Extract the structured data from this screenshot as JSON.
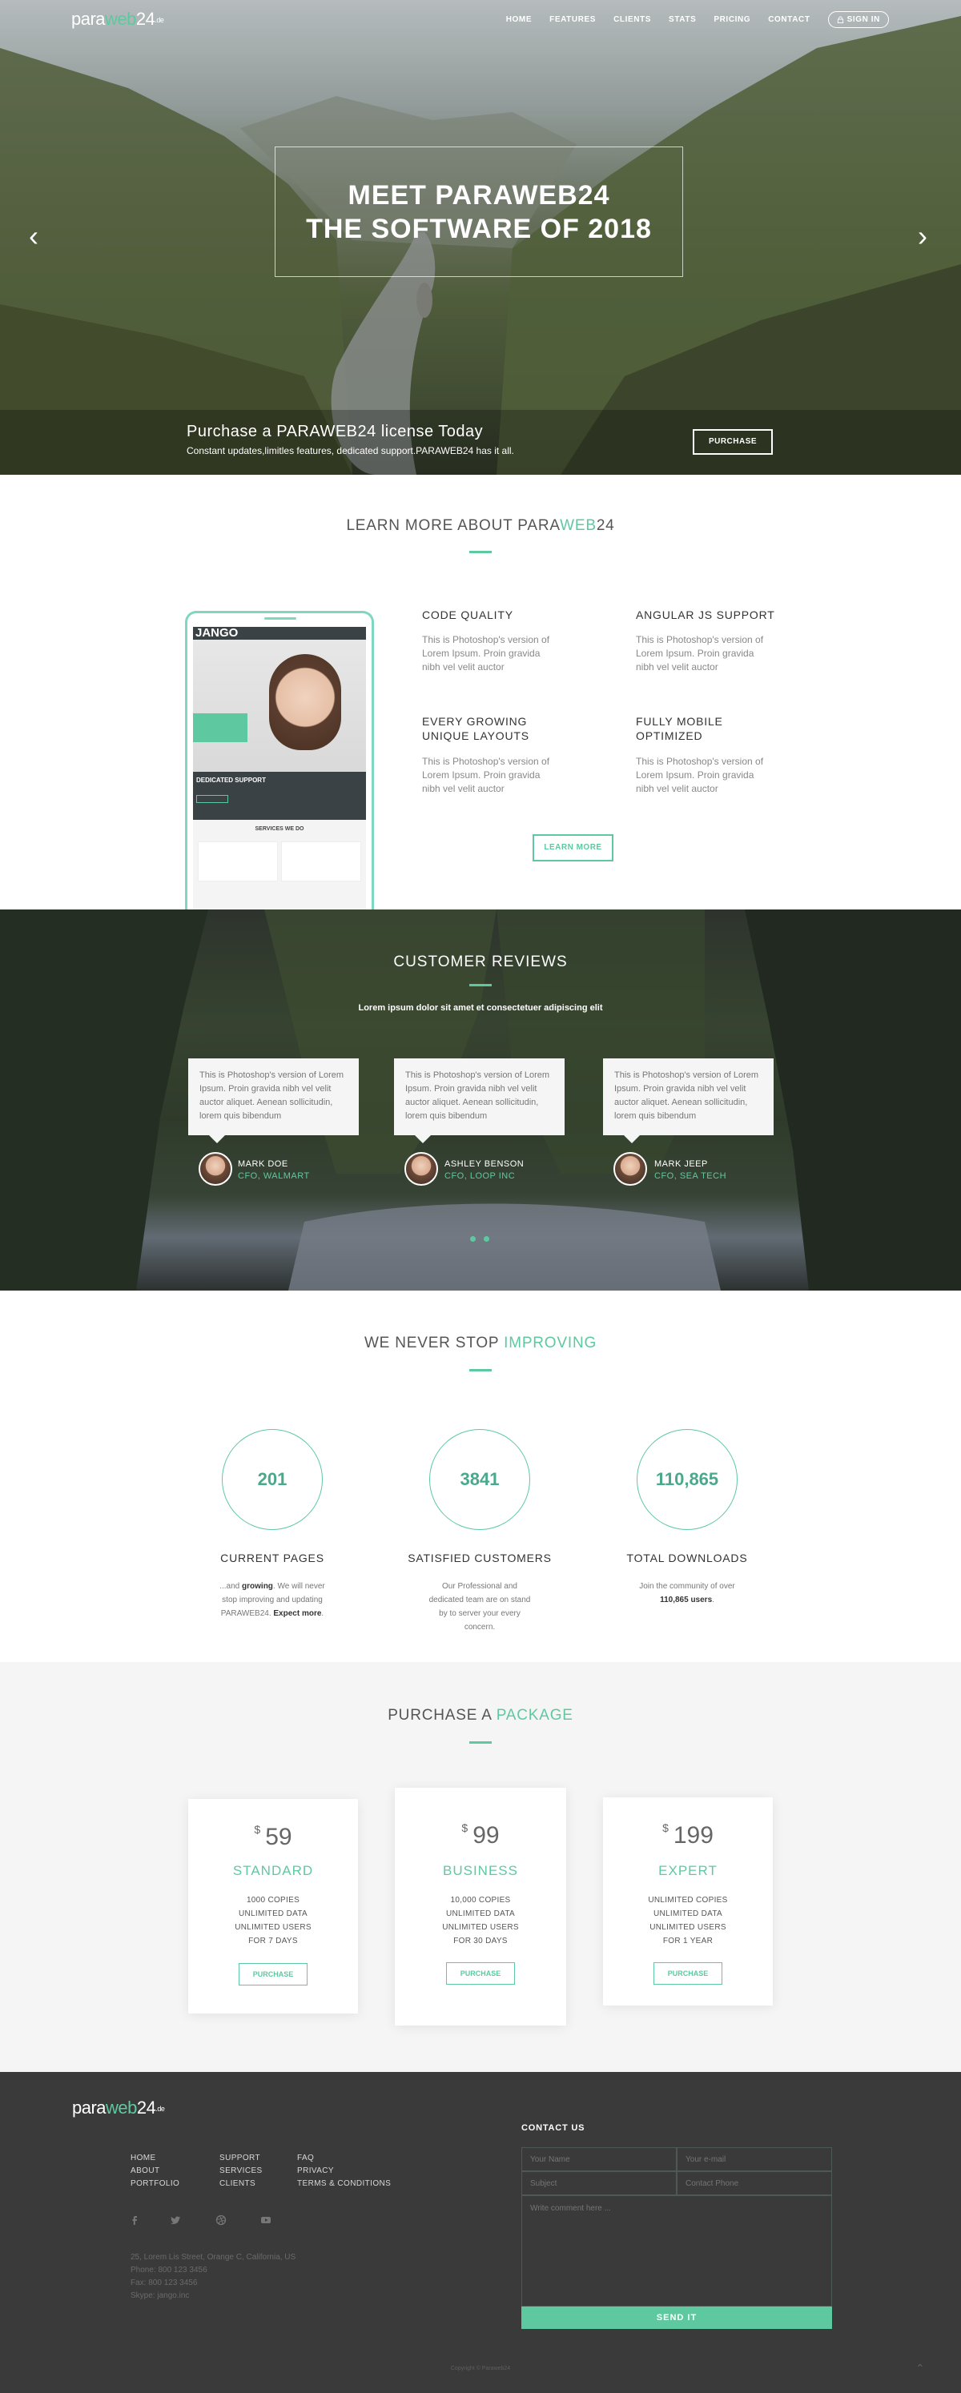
{
  "brand": {
    "logo_a": "para",
    "logo_b": "web",
    "logo_c": "24",
    "logo_tld": ".de"
  },
  "nav": {
    "items": [
      "HOME",
      "FEATURES",
      "CLIENTS",
      "STATS",
      "PRICING",
      "CONTACT"
    ],
    "signin": "SIGN IN"
  },
  "hero": {
    "line1": "MEET PARAWEB24",
    "line2": "THE SOFTWARE OF 2018",
    "prev": "‹",
    "next": "›",
    "band_title": "Purchase a PARAWEB24 license Today",
    "band_sub": "Constant updates,limitles features, dedicated support.PARAWEB24 has it all.",
    "purchase": "PURCHASE"
  },
  "learn": {
    "title_a": "LEARN MORE ABOUT PARA",
    "title_b": "WEB",
    "title_c": "24",
    "phone": {
      "brand": "JANGO",
      "support": "DEDICATED SUPPORT",
      "services": "SERVICES WE DO"
    },
    "features": [
      {
        "title": "CODE QUALITY",
        "text": "This is Photoshop's version of Lorem Ipsum. Proin gravida nibh vel velit auctor"
      },
      {
        "title": "ANGULAR JS SUPPORT",
        "text": "This is Photoshop's version of Lorem Ipsum. Proin gravida nibh vel velit auctor"
      },
      {
        "title": "EVERY GROWING UNIQUE LAYOUTS",
        "text": "This is Photoshop's version of Lorem Ipsum. Proin gravida nibh vel velit auctor"
      },
      {
        "title": "FULLY MOBILE OPTIMIZED",
        "text": "This is Photoshop's version of Lorem Ipsum. Proin gravida nibh vel velit auctor"
      }
    ],
    "button": "LEARN MORE"
  },
  "reviews": {
    "title": "CUSTOMER REVIEWS",
    "subtitle": "Lorem ipsum dolor sit amet et consectetuer adipiscing elit",
    "items": [
      {
        "text": "This is Photoshop's version  of Lorem Ipsum. Proin gravida nibh vel velit auctor aliquet. Aenean sollicitudin, lorem quis bibendum",
        "name": "MARK DOE",
        "role": "CFO, WALMART"
      },
      {
        "text": "This is Photoshop's version  of Lorem Ipsum. Proin gravida nibh vel velit auctor aliquet. Aenean sollicitudin, lorem quis bibendum",
        "name": "ASHLEY BENSON",
        "role": "CFO, LOOP INC"
      },
      {
        "text": "This is Photoshop's version  of Lorem Ipsum. Proin gravida nibh vel velit auctor aliquet. Aenean sollicitudin, lorem quis bibendum",
        "name": "MARK JEEP",
        "role": "CFO, SEA TECH"
      }
    ]
  },
  "stats": {
    "title_a": "WE NEVER STOP ",
    "title_b": "IMPROVING",
    "items": [
      {
        "value": "201",
        "label": "CURRENT PAGES",
        "p1": "...and ",
        "p1b": "growing",
        "p2": ". We will never stop improving and updating PARAWEB24. ",
        "p2b": "Expect more",
        "p3": "."
      },
      {
        "value": "3841",
        "label": "SATISFIED CUSTOMERS",
        "p1": "Our Professional and dedicated team are on stand by to server your every concern."
      },
      {
        "value": "110,865",
        "label": "TOTAL DOWNLOADS",
        "p1": "Join the community of over",
        "p1b": "110,865 users",
        "p2": "."
      }
    ]
  },
  "pricing": {
    "title_a": "PURCHASE A ",
    "title_b": "PACKAGE",
    "currency": "$",
    "plans": [
      {
        "price": "59",
        "name": "STANDARD",
        "lines": [
          "1000 COPIES",
          "UNLIMITED DATA",
          "UNLIMITED USERS",
          "FOR 7 DAYS"
        ],
        "button": "PURCHASE"
      },
      {
        "price": "99",
        "name": "BUSINESS",
        "lines": [
          "10,000 COPIES",
          "UNLIMITED DATA",
          "UNLIMITED USERS",
          "FOR 30 DAYS"
        ],
        "button": "PURCHASE"
      },
      {
        "price": "199",
        "name": "EXPERT",
        "lines": [
          "UNLIMITED COPIES",
          "UNLIMITED DATA",
          "UNLIMITED USERS",
          "FOR 1 YEAR"
        ],
        "button": "PURCHASE"
      }
    ]
  },
  "footer": {
    "col1": [
      "HOME",
      "ABOUT",
      "PORTFOLIO"
    ],
    "col2": [
      "SUPPORT",
      "SERVICES",
      "CLIENTS"
    ],
    "col3": [
      "FAQ",
      "PRIVACY",
      "TERMS & CONDITIONS"
    ],
    "address": [
      "25, Lorem Lis Street, Orange C, California, US",
      "Phone: 800 123 3456",
      "Fax: 800 123 3456",
      "Skype: jango.inc"
    ],
    "contact_title": "CONTACT US",
    "ph_name": "Your Name",
    "ph_email": "Your e-mail",
    "ph_subject": "Subject",
    "ph_phone": "Contact Phone",
    "ph_comment": "Write comment here ...",
    "send": "SEND IT",
    "copyright": "Copyright © Paraweb24",
    "totop": "⌃"
  },
  "colors": {
    "accent": "#5ec9a0",
    "footer_bg": "#3a3a3a",
    "pricing_bg": "#f5f5f5"
  }
}
